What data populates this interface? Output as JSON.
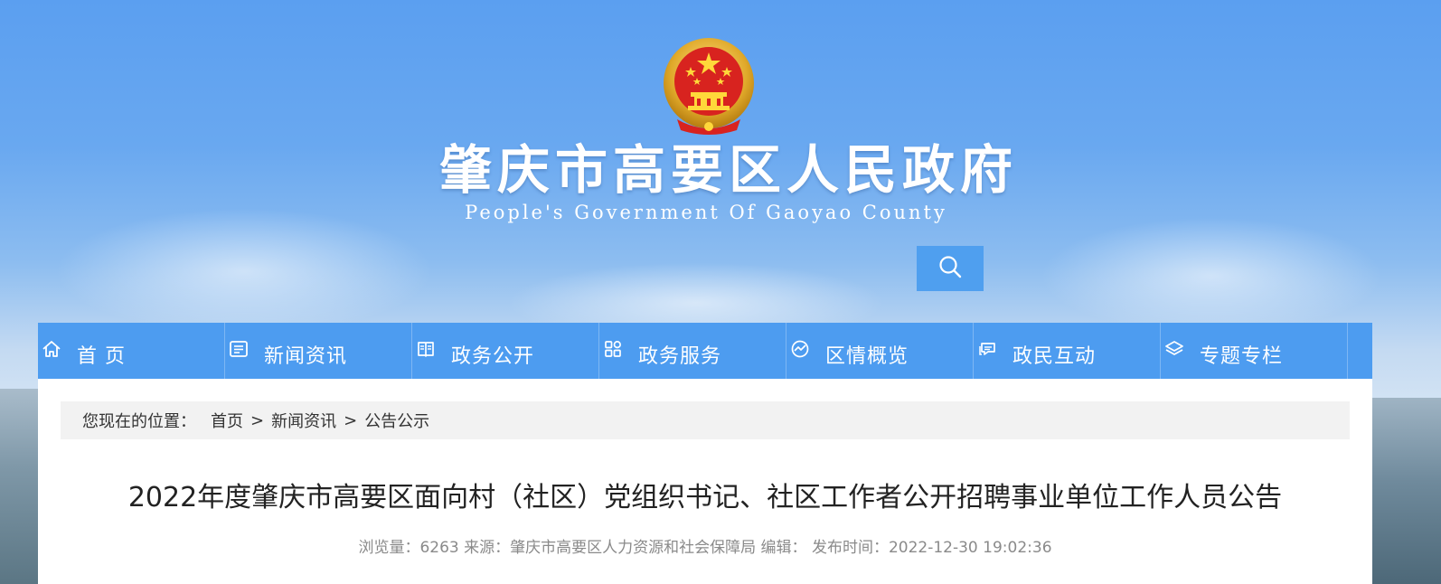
{
  "header": {
    "title": "肇庆市高要区人民政府",
    "subtitle": "People's Government Of Gaoyao County",
    "emblem": "national-emblem",
    "search_icon": "search-icon"
  },
  "nav": {
    "items": [
      {
        "label": "首 页",
        "icon": "home-icon"
      },
      {
        "label": "新闻资讯",
        "icon": "news-icon"
      },
      {
        "label": "政务公开",
        "icon": "book-icon"
      },
      {
        "label": "政务服务",
        "icon": "grid-icon"
      },
      {
        "label": "区情概览",
        "icon": "overview-icon"
      },
      {
        "label": "政民互动",
        "icon": "chat-icon"
      },
      {
        "label": "专题专栏",
        "icon": "layers-icon"
      }
    ]
  },
  "breadcrumb": {
    "prefix": "您现在的位置：",
    "items": [
      "首页",
      "新闻资讯",
      "公告公示"
    ],
    "separator": ">"
  },
  "article": {
    "title": "2022年度肇庆市高要区面向村（社区）党组织书记、社区工作者公开招聘事业单位工作人员公告",
    "views_label": "浏览量：",
    "views": "6263",
    "source_label": "来源：",
    "source": "肇庆市高要区人力资源和社会保障局",
    "editor_label": "编辑：",
    "editor": "",
    "published_label": "发布时间：",
    "published": "2022-12-30 19:02:36"
  },
  "colors": {
    "nav_bg": "#4d9cf0",
    "search_bg": "#4f9fef",
    "breadcrumb_bg": "#f2f2f2",
    "meta_text": "#8a8a8a"
  }
}
